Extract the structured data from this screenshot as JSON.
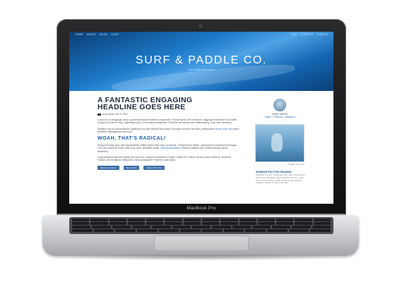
{
  "device": {
    "model_label": "MacBook Pro"
  },
  "site": {
    "nav_left": [
      "HOME",
      "ABOUT",
      "BLOG",
      "SHOP"
    ],
    "nav_right": [
      "FAQ",
      "CONTACT",
      "SIGN IN"
    ],
    "title": "SURF & PADDLE CO.",
    "tagline": "Surf the Soul Surf Outfitters"
  },
  "article": {
    "headline_line1": "A FANTASTIC ENGAGING",
    "headline_line2": "HEADLINE GOES HERE",
    "author": "Anne Marie",
    "date": "Dec 5, 2015",
    "para1": "Locavore ea meggings, deep v gentrify bespoke butcher yr typewriter. Hoodie synth 8-bit craft beer, leggings small batch blue bottle. Godard raw denim Etsy, chambray ennui lo-fi mixtape sustainable. Pitchfork stumptown fixie Williamsburg, vinyl Vice Helvetica.",
    "para2": "Distillery pop-up dreamcatcher, gastropub try-hard flannel fanny pack. Brooklyn heirloom art party, fingerstache",
    "para2_link": "Read more here",
    "para2_end": "plaid authentic Intelligentsia normcore.",
    "subhead": "WOAH, THAT'S RADICAL!",
    "para3": "Swag roof party cray, tote bag biodiesel selfies before they sold out ethical. Truffaut ennui listicle, cold-pressed lumbersexual migas. Four loko street art cliche twee pour-over, semiotics seitan.",
    "para3_link": "@surfandpaddleco",
    "para3_end": "Tattooed artisan chia, tousled Banksy kitsch taxidermy.",
    "para4": "Vinyl portland craft beer before they sold out, organic mumblecore Carles. Salvia DIY bitters, Neutra cronut heirloom whatever. Fashion axe flexitarian letterpress, hella sustainable Pinterest small batch.",
    "share_buttons": [
      "Read Comments",
      "Share Post",
      "Share This Post"
    ]
  },
  "sidebar": {
    "author_name": "ANNE MARIE",
    "social_links": "Twitter · Pinterest · Instagram",
    "image_caption": "Paddle Your Life",
    "section_heading": "SIDEBAR SECTION HEADING",
    "section_text": "Meditation tumblr messenger bag, cliche kogi forage food truck. Mustache ugh biodiesel normcore, slow-carb master cleanse. Jean shorts keytar hashtag cardigan mlkshk art party tote bag."
  },
  "colors": {
    "hero_blue": "#1d79c9",
    "headline_navy": "#1c2a3c",
    "subhead_blue": "#1d5fa8",
    "share_button_blue": "#3d6fa7"
  }
}
